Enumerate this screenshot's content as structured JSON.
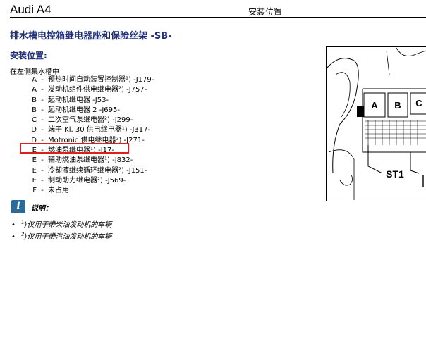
{
  "header": {
    "model": "Audi A4",
    "title": "安装位置"
  },
  "document": {
    "title": "排水槽电控箱继电器座和保险丝架 -SB-",
    "section_title": "安装位置:",
    "intro": "在左侧集水槽中",
    "items": [
      {
        "code": "A",
        "sep": "-",
        "text": "预热时间自动装置控制器¹) -J179-"
      },
      {
        "code": "A",
        "sep": "-",
        "text": "发动机组件供电继电器²) -J757-"
      },
      {
        "code": "B",
        "sep": "-",
        "text": "起动机继电器 -J53-"
      },
      {
        "code": "B",
        "sep": "-",
        "text": "起动机继电器 2 -J695-"
      },
      {
        "code": "C",
        "sep": "-",
        "text": "二次空气泵继电器²) -J299-"
      },
      {
        "code": "D",
        "sep": "-",
        "text": "端子 Kl. 30 供电继电器¹) -J317-"
      },
      {
        "code": "D",
        "sep": "-",
        "text": "Motronic 供电继电器²) -J271-"
      },
      {
        "code": "E",
        "sep": "-",
        "text": "燃油泵继电器¹) -J17-"
      },
      {
        "code": "E",
        "sep": "-",
        "text": "辅助燃油泵继电器¹) -J832-"
      },
      {
        "code": "E",
        "sep": "-",
        "text": "冷却液继续循环继电器²) -J151-"
      },
      {
        "code": "E",
        "sep": "-",
        "text": "制动助力继电器²) -J569-"
      },
      {
        "code": "F",
        "sep": "-",
        "text": "未占用"
      }
    ],
    "note": {
      "icon": "info-icon",
      "icon_glyph": "i",
      "label": "说明：",
      "footnotes": [
        {
          "bullet": "•",
          "mark": "1",
          "text": ")仅用于带柴油发动机的车辆"
        },
        {
          "bullet": "•",
          "mark": "2",
          "text": ")仅用于带汽油发动机的车辆"
        }
      ]
    },
    "highlight_color": "#e01e1e"
  },
  "figure": {
    "labels": {
      "a": "A",
      "b": "B",
      "c": "C",
      "st1": "ST1"
    }
  }
}
